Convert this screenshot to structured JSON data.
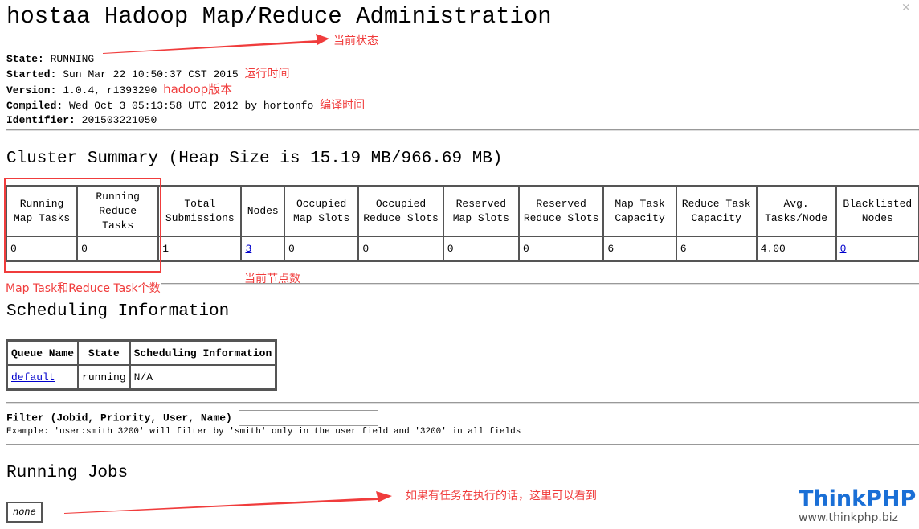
{
  "page_title": "hostaa Hadoop Map/Reduce Administration",
  "info": [
    {
      "label": "State:",
      "value": "RUNNING"
    },
    {
      "label": "Started:",
      "value": "Sun Mar 22 10:50:37 CST 2015"
    },
    {
      "label": "Version:",
      "value": "1.0.4, r1393290"
    },
    {
      "label": "Compiled:",
      "value": "Wed Oct 3 05:13:58 UTC 2012 by hortonfo"
    },
    {
      "label": "Identifier:",
      "value": "201503221050"
    }
  ],
  "annotations": {
    "state": "当前状态",
    "started": "运行时间",
    "version": "hadoop版本",
    "compiled": "编译时间",
    "tasks": "Map Task和Reduce Task个数",
    "nodes": "当前节点数",
    "jobs": "如果有任务在执行的话，这里可以看到"
  },
  "cluster": {
    "title": "Cluster Summary (Heap Size is 15.19 MB/966.69 MB)",
    "headers": [
      "Running Map Tasks",
      "Running Reduce Tasks",
      "Total Submissions",
      "Nodes",
      "Occupied Map Slots",
      "Occupied Reduce Slots",
      "Reserved Map Slots",
      "Reserved Reduce Slots",
      "Map Task Capacity",
      "Reduce Task Capacity",
      "Avg. Tasks/Node",
      "Blacklisted Nodes"
    ],
    "values": [
      "0",
      "0",
      "1",
      "3",
      "0",
      "0",
      "0",
      "0",
      "6",
      "6",
      "4.00",
      "0"
    ]
  },
  "scheduling": {
    "title": "Scheduling Information",
    "headers": [
      "Queue Name",
      "State",
      "Scheduling Information"
    ],
    "row": [
      "default",
      "running",
      "N/A"
    ]
  },
  "filter": {
    "label": "Filter (Jobid, Priority, User, Name)",
    "value": "",
    "example": "Example: 'user:smith 3200' will filter by 'smith' only in the user field and '3200' in all fields"
  },
  "running_jobs": {
    "title": "Running Jobs",
    "empty": "none"
  },
  "watermark": {
    "brand": "ThinkPHP",
    "url": "www.thinkphp.biz"
  },
  "colors": {
    "annotation": "#f03c3c",
    "link": "#0000cc",
    "brand": "#1a6fd6"
  }
}
